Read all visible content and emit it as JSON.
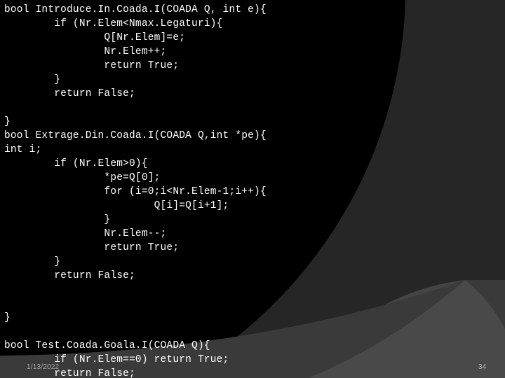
{
  "slide": {
    "background_color": "#000000",
    "shapes": {
      "large_arc_color": "#262626",
      "lower_left_band_color": "#3a3a3a",
      "lower_right_arc_color": "#444444"
    }
  },
  "code": {
    "language": "C",
    "lines": [
      "bool Introduce.In.Coada.I(COADA Q, int e){",
      "        if (Nr.Elem<Nmax.Legaturi){",
      "                Q[Nr.Elem]=e;",
      "                Nr.Elem++;",
      "                return True;",
      "        }",
      "        return False;",
      "",
      "}",
      "bool Extrage.Din.Coada.I(COADA Q,int *pe){",
      "int i;",
      "        if (Nr.Elem>0){",
      "                *pe=Q[0];",
      "                for (i=0;i<Nr.Elem-1;i++){",
      "                        Q[i]=Q[i+1];",
      "                }",
      "                Nr.Elem--;",
      "                return True;",
      "        }",
      "        return False;",
      "",
      "",
      "}",
      "",
      "bool Test.Coada.Goala.I(COADA Q){",
      "        if (Nr.Elem==0) return True;",
      "        return False;",
      "",
      "}"
    ]
  },
  "footer": {
    "date": "1/13/2022",
    "page_number": "34"
  }
}
